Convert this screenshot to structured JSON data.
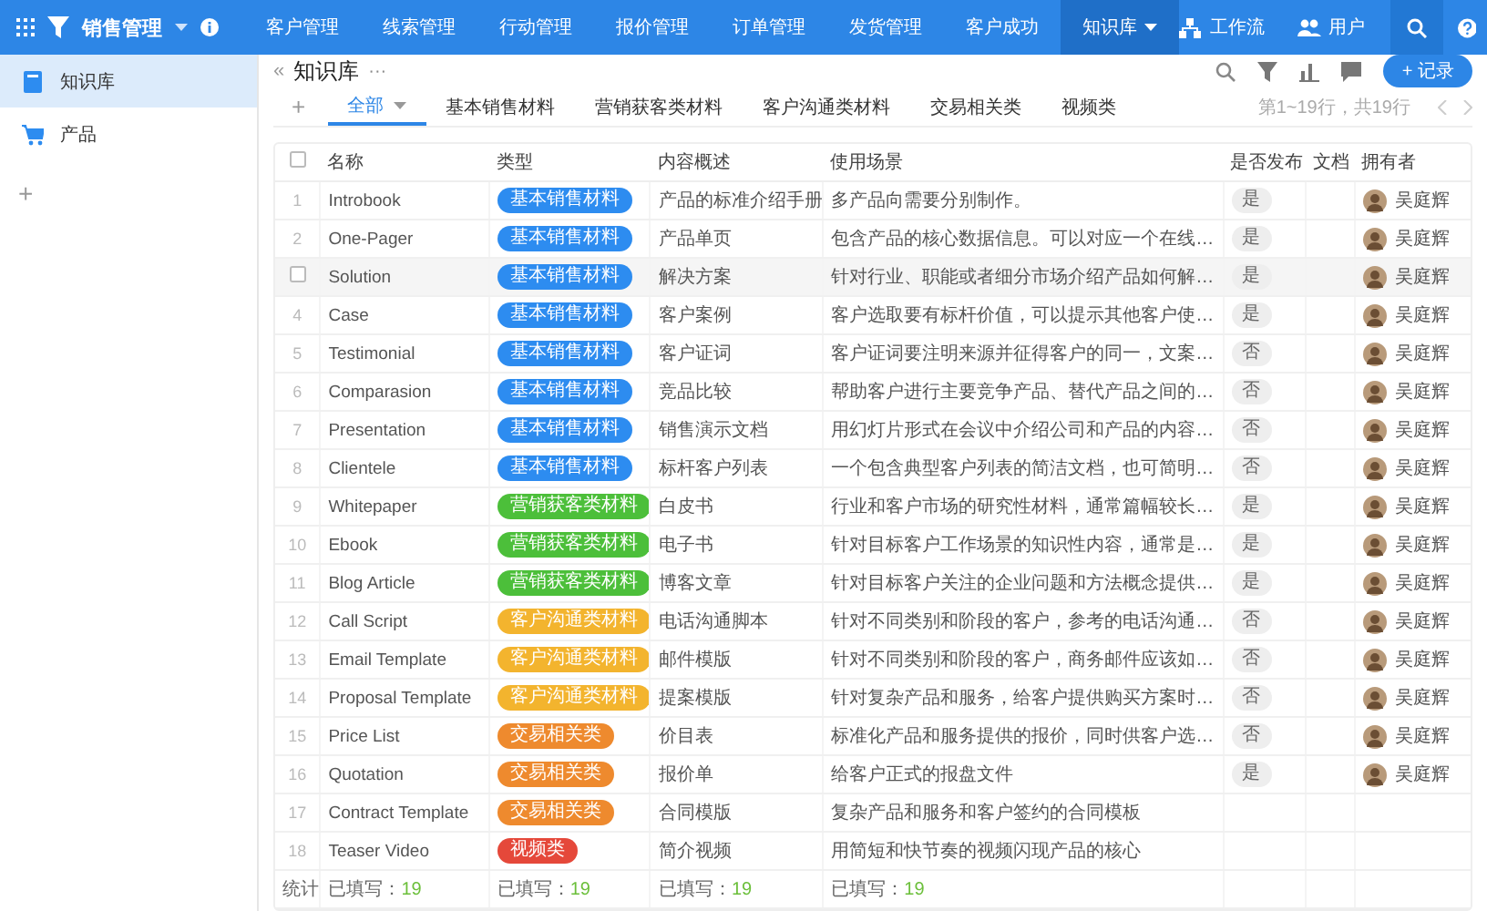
{
  "app": {
    "title": "销售管理"
  },
  "nav": [
    {
      "label": "客户管理",
      "selected": false
    },
    {
      "label": "线索管理",
      "selected": false
    },
    {
      "label": "行动管理",
      "selected": false
    },
    {
      "label": "报价管理",
      "selected": false
    },
    {
      "label": "订单管理",
      "selected": false
    },
    {
      "label": "发货管理",
      "selected": false
    },
    {
      "label": "客户成功",
      "selected": false
    },
    {
      "label": "知识库",
      "selected": true
    }
  ],
  "nav_right": [
    {
      "kind": "workflow",
      "label": "工作流"
    },
    {
      "kind": "users",
      "label": "用户"
    }
  ],
  "sidebar": {
    "items": [
      {
        "kind": "book",
        "label": "知识库",
        "selected": true
      },
      {
        "kind": "cart",
        "label": "产品",
        "selected": false
      }
    ],
    "add": "+"
  },
  "page": {
    "title": "知识库",
    "back": "«",
    "more": "···",
    "add_button": "+ 记录",
    "add_tab": "+",
    "tabs": [
      {
        "label": "全部",
        "selected": true
      },
      {
        "label": "基本销售材料",
        "selected": false
      },
      {
        "label": "营销获客类材料",
        "selected": false
      },
      {
        "label": "客户沟通类材料",
        "selected": false
      },
      {
        "label": "交易相关类",
        "selected": false
      },
      {
        "label": "视频类",
        "selected": false
      }
    ],
    "pagination": "第1~19行，共19行"
  },
  "table": {
    "select_all": {
      "checked": false
    },
    "columns": [
      "名称",
      "类型",
      "内容概述",
      "使用场景",
      "是否发布",
      "文档",
      "拥有者"
    ],
    "rows": [
      {
        "no": "1",
        "checked": false,
        "hovered": false,
        "name": "Introbook",
        "type": {
          "label": "基本销售材料",
          "color": "#2d8cf0"
        },
        "summary": "产品的标准介绍手册",
        "usage": "多产品向需要分别制作。",
        "published": "是",
        "owner": "吴庭辉"
      },
      {
        "no": "2",
        "checked": false,
        "hovered": false,
        "name": "One-Pager",
        "type": {
          "label": "基本销售材料",
          "color": "#2d8cf0"
        },
        "summary": "产品单页",
        "usage": "包含产品的核心数据信息。可以对应一个在线…",
        "published": "是",
        "owner": "吴庭辉"
      },
      {
        "checked": false,
        "hovered": true,
        "name": "Solution",
        "type": {
          "label": "基本销售材料",
          "color": "#2d8cf0"
        },
        "summary": "解决方案",
        "usage": "针对行业、职能或者细分市场介绍产品如何解…",
        "published": "是",
        "owner": "吴庭辉"
      },
      {
        "no": "4",
        "checked": false,
        "hovered": false,
        "name": "Case",
        "type": {
          "label": "基本销售材料",
          "color": "#2d8cf0"
        },
        "summary": "客户案例",
        "usage": "客户选取要有标杆价值，可以提示其他客户使…",
        "published": "是",
        "owner": "吴庭辉"
      },
      {
        "no": "5",
        "checked": false,
        "hovered": false,
        "name": "Testimonial",
        "type": {
          "label": "基本销售材料",
          "color": "#2d8cf0"
        },
        "summary": "客户证词",
        "usage": "客户证词要注明来源并征得客户的同一，文案…",
        "published": "否",
        "owner": "吴庭辉"
      },
      {
        "no": "6",
        "checked": false,
        "hovered": false,
        "name": "Comparasion",
        "type": {
          "label": "基本销售材料",
          "color": "#2d8cf0"
        },
        "summary": "竞品比较",
        "usage": "帮助客户进行主要竞争产品、替代产品之间的…",
        "published": "否",
        "owner": "吴庭辉"
      },
      {
        "no": "7",
        "checked": false,
        "hovered": false,
        "name": "Presentation",
        "type": {
          "label": "基本销售材料",
          "color": "#2d8cf0"
        },
        "summary": "销售演示文档",
        "usage": "用幻灯片形式在会议中介绍公司和产品的内容…",
        "published": "否",
        "owner": "吴庭辉"
      },
      {
        "no": "8",
        "checked": false,
        "hovered": false,
        "name": "Clientele",
        "type": {
          "label": "基本销售材料",
          "color": "#2d8cf0"
        },
        "summary": "标杆客户列表",
        "usage": "一个包含典型客户列表的简洁文档，也可简明…",
        "published": "否",
        "owner": "吴庭辉"
      },
      {
        "no": "9",
        "checked": false,
        "hovered": false,
        "name": "Whitepaper",
        "type": {
          "label": "营销获客类材料",
          "color": "#4cbf3a"
        },
        "summary": "白皮书",
        "usage": "行业和客户市场的研究性材料，通常篇幅较长…",
        "published": "是",
        "owner": "吴庭辉"
      },
      {
        "no": "10",
        "checked": false,
        "hovered": false,
        "name": "Ebook",
        "type": {
          "label": "营销获客类材料",
          "color": "#4cbf3a"
        },
        "summary": "电子书",
        "usage": "针对目标客户工作场景的知识性内容，通常是…",
        "published": "是",
        "owner": "吴庭辉"
      },
      {
        "no": "11",
        "checked": false,
        "hovered": false,
        "name": "Blog Article",
        "type": {
          "label": "营销获客类材料",
          "color": "#4cbf3a"
        },
        "summary": "博客文章",
        "usage": "针对目标客户关注的企业问题和方法概念提供…",
        "published": "是",
        "owner": "吴庭辉"
      },
      {
        "no": "12",
        "checked": false,
        "hovered": false,
        "name": "Call Script",
        "type": {
          "label": "客户沟通类材料",
          "color": "#f3b42e"
        },
        "summary": "电话沟通脚本",
        "usage": "针对不同类别和阶段的客户，参考的电话沟通…",
        "published": "否",
        "owner": "吴庭辉"
      },
      {
        "no": "13",
        "checked": false,
        "hovered": false,
        "name": "Email Template",
        "type": {
          "label": "客户沟通类材料",
          "color": "#f3b42e"
        },
        "summary": "邮件模版",
        "usage": "针对不同类别和阶段的客户，商务邮件应该如…",
        "published": "否",
        "owner": "吴庭辉"
      },
      {
        "no": "14",
        "checked": false,
        "hovered": false,
        "name": "Proposal Template",
        "type": {
          "label": "客户沟通类材料",
          "color": "#f3b42e"
        },
        "summary": "提案模版",
        "usage": "针对复杂产品和服务，给客户提供购买方案时…",
        "published": "否",
        "owner": "吴庭辉"
      },
      {
        "no": "15",
        "checked": false,
        "hovered": false,
        "name": "Price List",
        "type": {
          "label": "交易相关类",
          "color": "#ee8a2e"
        },
        "summary": "价目表",
        "usage": "标准化产品和服务提供的报价，同时供客户选…",
        "published": "否",
        "owner": "吴庭辉"
      },
      {
        "no": "16",
        "checked": false,
        "hovered": false,
        "name": "Quotation",
        "type": {
          "label": "交易相关类",
          "color": "#ee8a2e"
        },
        "summary": "报价单",
        "usage": "给客户正式的报盘文件",
        "published": "是",
        "owner": "吴庭辉"
      },
      {
        "no": "17",
        "checked": false,
        "hovered": false,
        "name": "Contract Template",
        "type": {
          "label": "交易相关类",
          "color": "#ee8a2e"
        },
        "summary": "合同模版",
        "usage": "复杂产品和服务和客户签约的合同模板"
      },
      {
        "no": "18",
        "checked": false,
        "hovered": false,
        "name": "Teaser Video",
        "type": {
          "label": "视频类",
          "color": "#e5483a"
        },
        "summary": "简介视频",
        "usage": "用简短和快节奏的视频闪现产品的核心"
      }
    ],
    "footer": {
      "label": "统计",
      "cells": [
        {
          "label": "已填写：",
          "count": "19"
        },
        {
          "label": "已填写：",
          "count": "19"
        },
        {
          "label": "已填写：",
          "count": "19"
        },
        {
          "label": "已填写：",
          "count": "19"
        }
      ]
    }
  }
}
